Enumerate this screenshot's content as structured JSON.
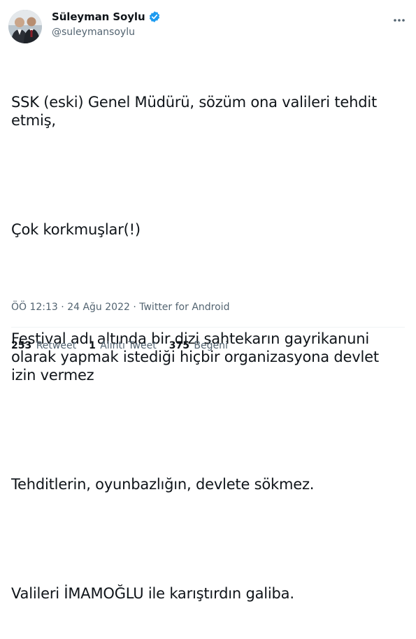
{
  "author": {
    "display_name": "Süleyman Soylu",
    "handle": "@suleymansoylu",
    "verified_icon": "verified-badge-icon",
    "verified_color": "#1d9bf0"
  },
  "tweet": {
    "lines": [
      "SSK (eski) Genel Müdürü, sözüm ona valileri tehdit etmiş,",
      "",
      "Çok korkmuşlar(!)",
      "",
      "Festival adı altında bir dizi sahtekarın gayrikanuni olarak yapmak istediği hiçbir organizasyona devlet izin vermez",
      "",
      "Tehditlerin, oyunbazlığın, devlete sökmez.",
      "",
      "Valileri İMAMOĞLU ile karıştırdın galiba."
    ]
  },
  "meta": {
    "time": "ÖÖ 12:13",
    "separator": "·",
    "date": "24 Ağu 2022",
    "source": "Twitter for Android"
  },
  "stats": {
    "retweets_count": "253",
    "retweets_label": "Retweet",
    "quotes_count": "1",
    "quotes_label": "Alıntı Tweet",
    "likes_count": "375",
    "likes_label": "Beğeni"
  },
  "colors": {
    "text": "#0f1419",
    "secondary": "#536471",
    "divider": "#eff3f4"
  }
}
